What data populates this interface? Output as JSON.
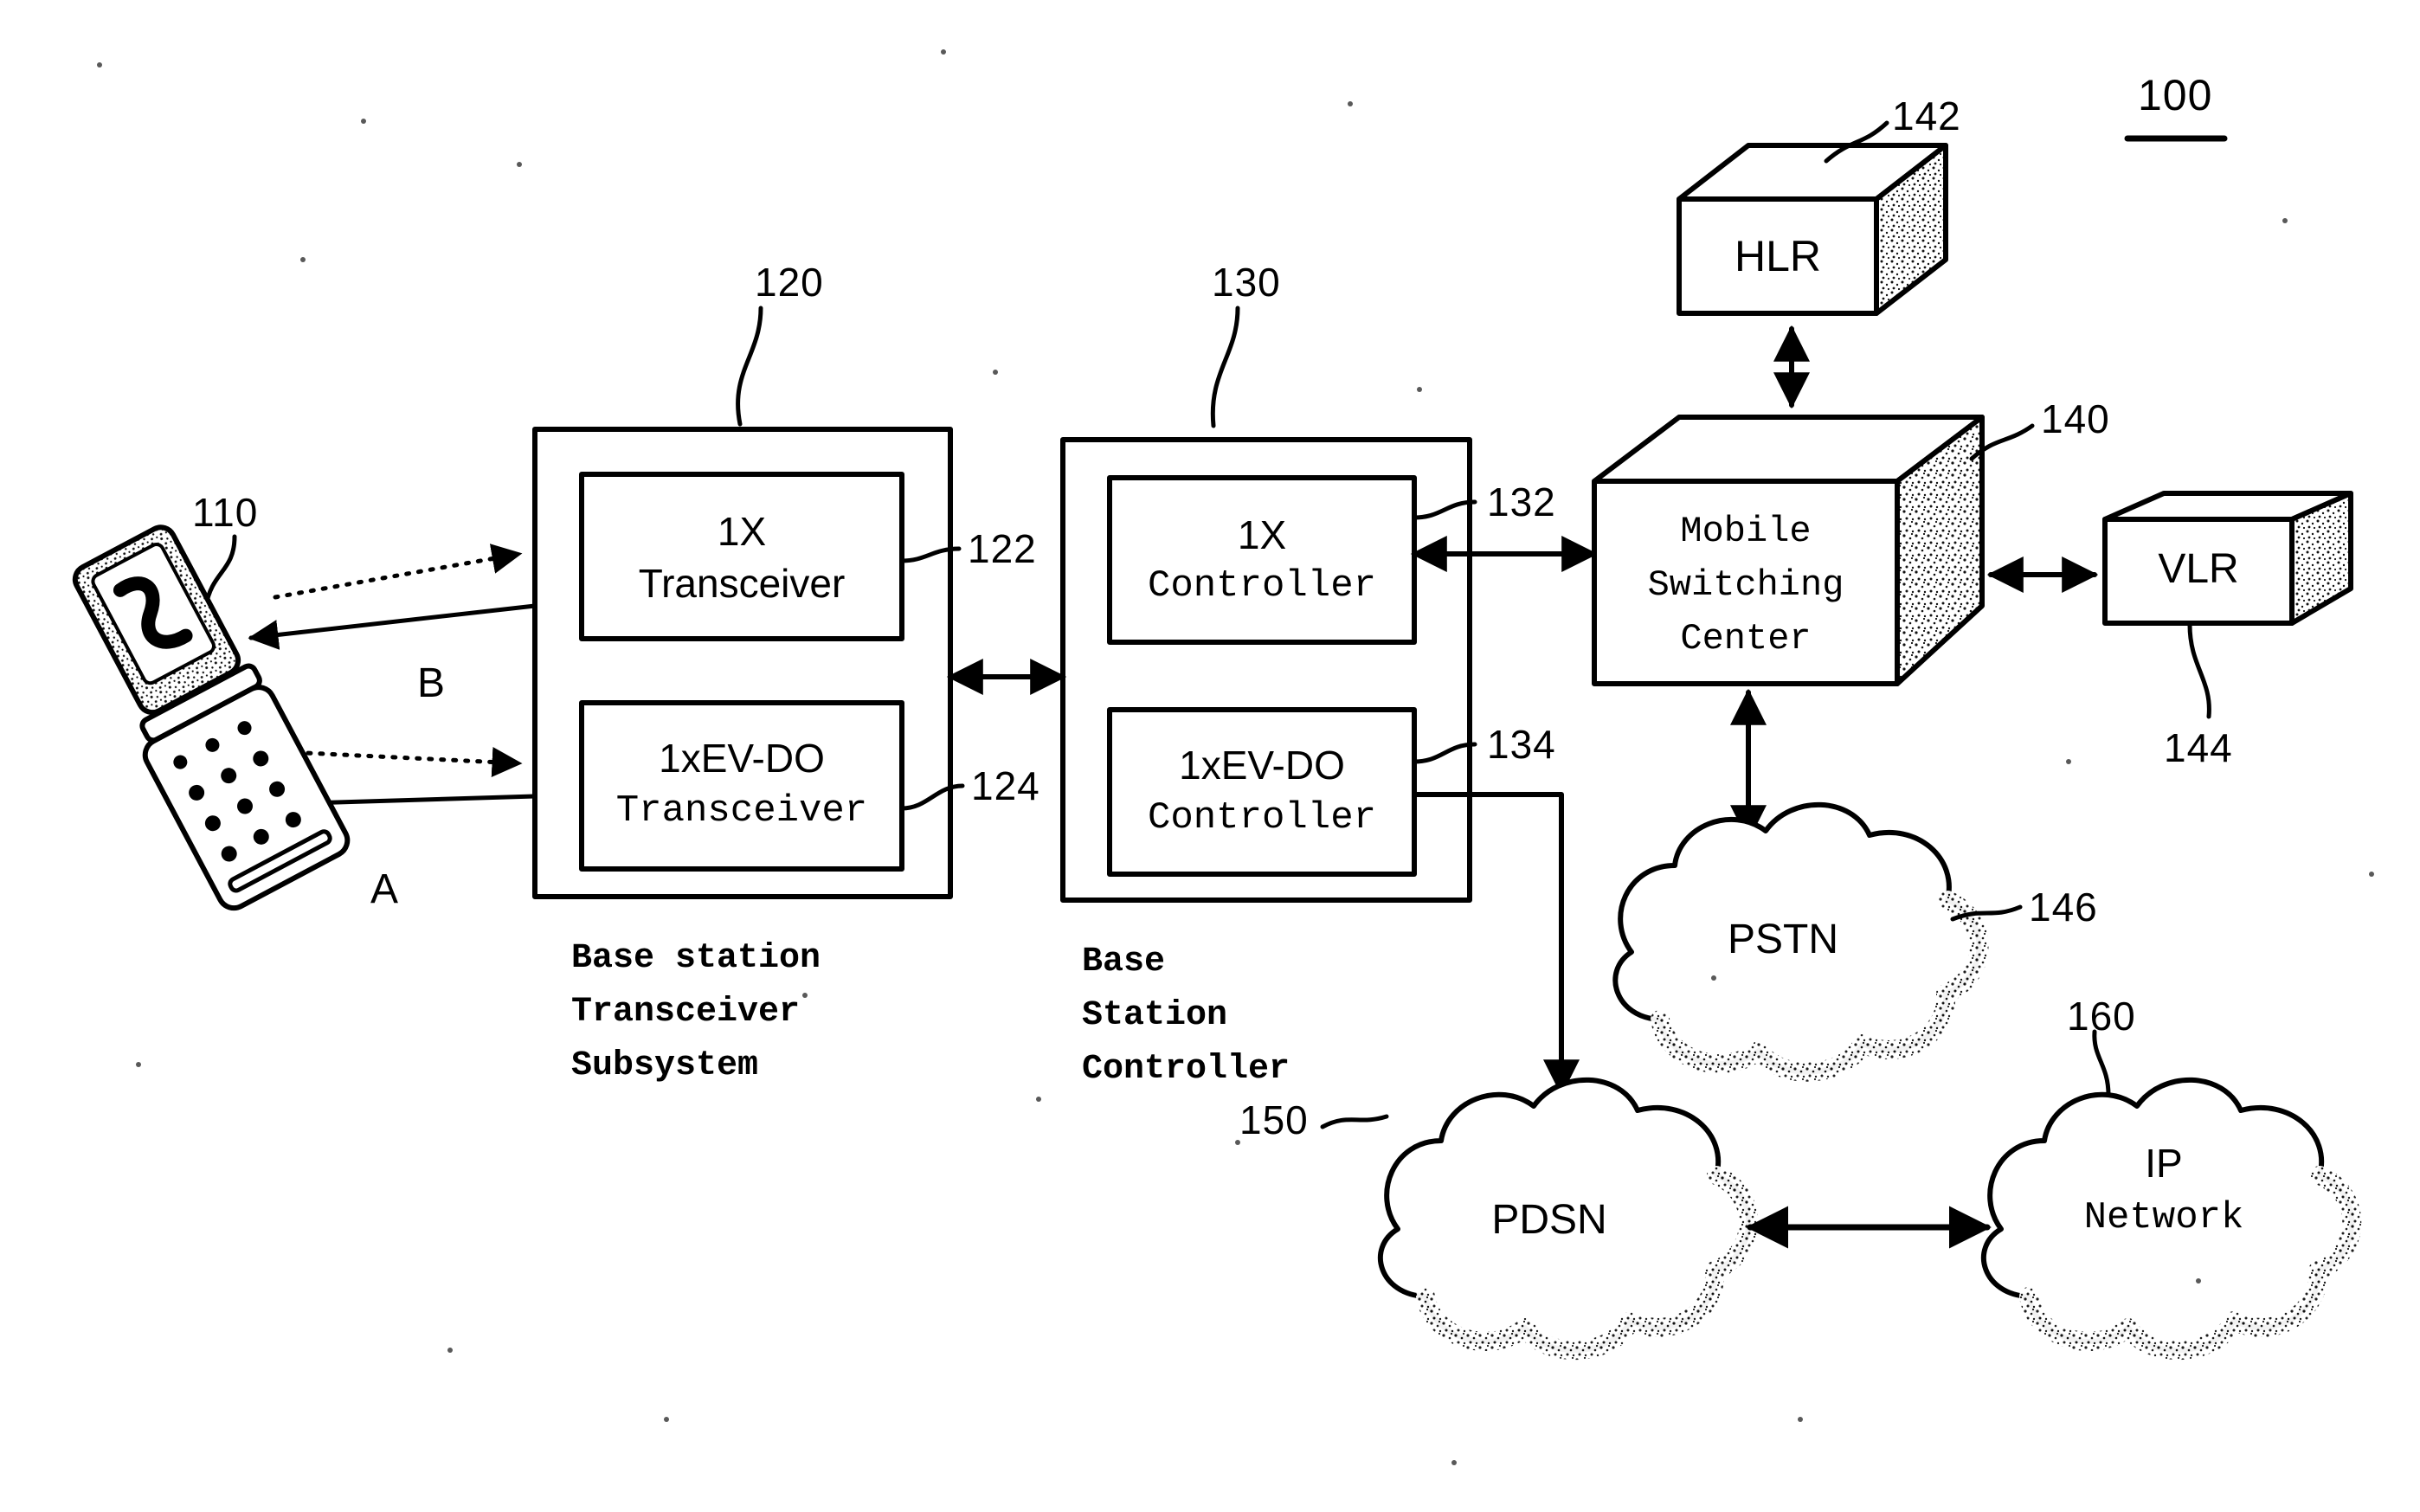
{
  "figure": {
    "figure_number": "100",
    "title_note": "100"
  },
  "nodes": {
    "mobile_station": {
      "ref": "110",
      "label": "",
      "icon": "flip-phone-icon"
    },
    "bts": {
      "ref": "120",
      "caption": "Base station\nTransceiver\nSubsystem",
      "caption_lines": [
        "Base station",
        "Transceiver",
        "Subsystem"
      ],
      "modules": [
        {
          "ref": "122",
          "line1": "1X",
          "line2": "Transceiver"
        },
        {
          "ref": "124",
          "line1": "1xEV-DO",
          "line2": "Transceiver"
        }
      ]
    },
    "bsc": {
      "ref": "130",
      "caption_lines": [
        "Base",
        "Station",
        "Controller"
      ],
      "modules": [
        {
          "ref": "132",
          "line1": "1X",
          "line2": "Controller"
        },
        {
          "ref": "134",
          "line1": "1xEV-DO",
          "line2": "Controller"
        }
      ]
    },
    "msc": {
      "ref": "140",
      "lines": [
        "Mobile",
        "Switching",
        "Center"
      ]
    },
    "hlr": {
      "ref": "142",
      "label": "HLR"
    },
    "vlr": {
      "ref": "144",
      "label": "VLR"
    },
    "pstn": {
      "ref": "146",
      "label": "PSTN"
    },
    "pdsn": {
      "ref": "150",
      "label": "PDSN"
    },
    "ip_network": {
      "ref": "160",
      "lines": [
        "IP",
        "Network"
      ]
    }
  },
  "link_labels": {
    "a": "A",
    "b": "B"
  }
}
